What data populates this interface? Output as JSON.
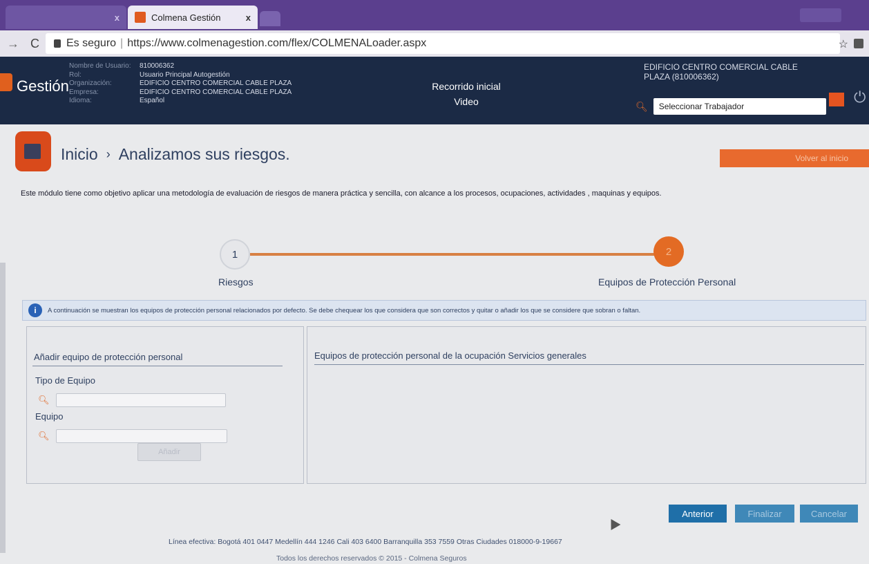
{
  "browser": {
    "tabs": [
      {
        "label": "",
        "active": false
      },
      {
        "label": "Colmena Gestión",
        "active": true
      }
    ],
    "tab_close": "x",
    "secure_label": "Es seguro",
    "url": "https://www.colmenagestion.com/flex/COLMENALoader.aspx"
  },
  "header": {
    "logo": "Gestión",
    "user_fields": [
      {
        "key": "Nombre de Usuario:",
        "value": "810006362"
      },
      {
        "key": "Rol:",
        "value": "Usuario Principal Autogestión"
      },
      {
        "key": "Organización:",
        "value": "EDIFICIO CENTRO COMERCIAL CABLE PLAZA"
      },
      {
        "key": "Empresa:",
        "value": "EDIFICIO CENTRO COMERCIAL CABLE PLAZA"
      },
      {
        "key": "Idioma:",
        "value": "Español"
      }
    ],
    "tour_line1": "Recorrido inicial",
    "tour_line2": "Video",
    "company": "EDIFICIO CENTRO COMERCIAL CABLE PLAZA (810006362)",
    "worker_select": "Seleccionar Trabajador"
  },
  "breadcrumb": {
    "home": "Inicio",
    "separator": "›",
    "current": "Analizamos sus riesgos."
  },
  "volver_button": "Volver al inicio",
  "intro_text": "Este módulo tiene como objetivo aplicar una metodología de evaluación de riesgos de manera práctica y sencilla, con alcance a los procesos, ocupaciones, actividades , maquinas y equipos.",
  "stepper": {
    "step1_number": "1",
    "step1_label": "Riesgos",
    "step2_number": "2",
    "step2_label": "Equipos de Protección Personal",
    "current_step": 2
  },
  "info_message": "A continuación se muestran los equipos de protección personal relacionados por defecto. Se debe chequear los que considera que son correctos y quitar o añadir los que se considere que sobran o faltan.",
  "left_panel": {
    "title": "Añadir equipo de protección personal",
    "field1_label": "Tipo de Equipo",
    "field1_value": "",
    "field2_label": "Equipo",
    "field2_value": "",
    "add_button": "Añadir"
  },
  "right_panel": {
    "title": "Equipos de protección personal de la ocupación Servicios generales"
  },
  "actions": {
    "anterior": "Anterior",
    "finalizar": "Finalizar",
    "cancelar": "Cancelar"
  },
  "footer": {
    "line1": "Línea efectiva: Bogotá 401 0447 Medellín 444 1246 Cali 403 6400 Barranquilla 353 7559 Otras Ciudades 018000-9-19667",
    "line2": "Todos los derechos reservados © 2015 - Colmena Seguros"
  },
  "colors": {
    "accent_orange": "#e36b24",
    "header_navy": "#1b2a45",
    "primary_blue": "#1f6fa8"
  }
}
